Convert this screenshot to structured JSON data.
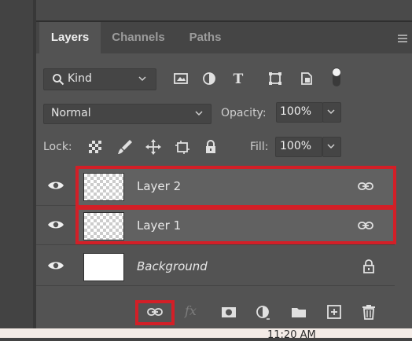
{
  "tabs": {
    "layers": "Layers",
    "channels": "Channels",
    "paths": "Paths"
  },
  "filter": {
    "kind_label": "Kind",
    "icons": [
      "image-filter-icon",
      "adjustment-filter-icon",
      "type-filter-icon",
      "shape-filter-icon",
      "smart-object-filter-icon",
      "filter-toggle-icon"
    ]
  },
  "blend": {
    "mode": "Normal",
    "opacity_label": "Opacity:",
    "opacity_value": "100%"
  },
  "lock": {
    "label": "Lock:",
    "icons": [
      "lock-transparent-pixels-icon",
      "lock-image-pixels-icon",
      "lock-position-icon",
      "lock-artboard-icon",
      "lock-all-icon"
    ],
    "fill_label": "Fill:",
    "fill_value": "100%"
  },
  "layers": [
    {
      "name": "Layer 2",
      "visible": true,
      "thumbnail": "transparent",
      "linked": true,
      "highlighted": true
    },
    {
      "name": "Layer 1",
      "visible": true,
      "thumbnail": "transparent",
      "linked": true,
      "highlighted": true
    },
    {
      "name": "Background",
      "visible": true,
      "thumbnail": "white",
      "locked": true,
      "highlighted": false
    }
  ],
  "bottom_toolbar": {
    "icons": [
      "link-layers-icon",
      "fx-icon",
      "add-mask-icon",
      "adjustment-layer-icon",
      "new-group-icon",
      "new-layer-icon",
      "delete-layer-icon"
    ],
    "fx_text": "fx",
    "highlighted": "link-layers-icon"
  },
  "colors": {
    "highlight": "#d31f27",
    "panel": "#535353",
    "selected_row": "#616161"
  },
  "footer": {
    "clock": "11:20 AM"
  }
}
